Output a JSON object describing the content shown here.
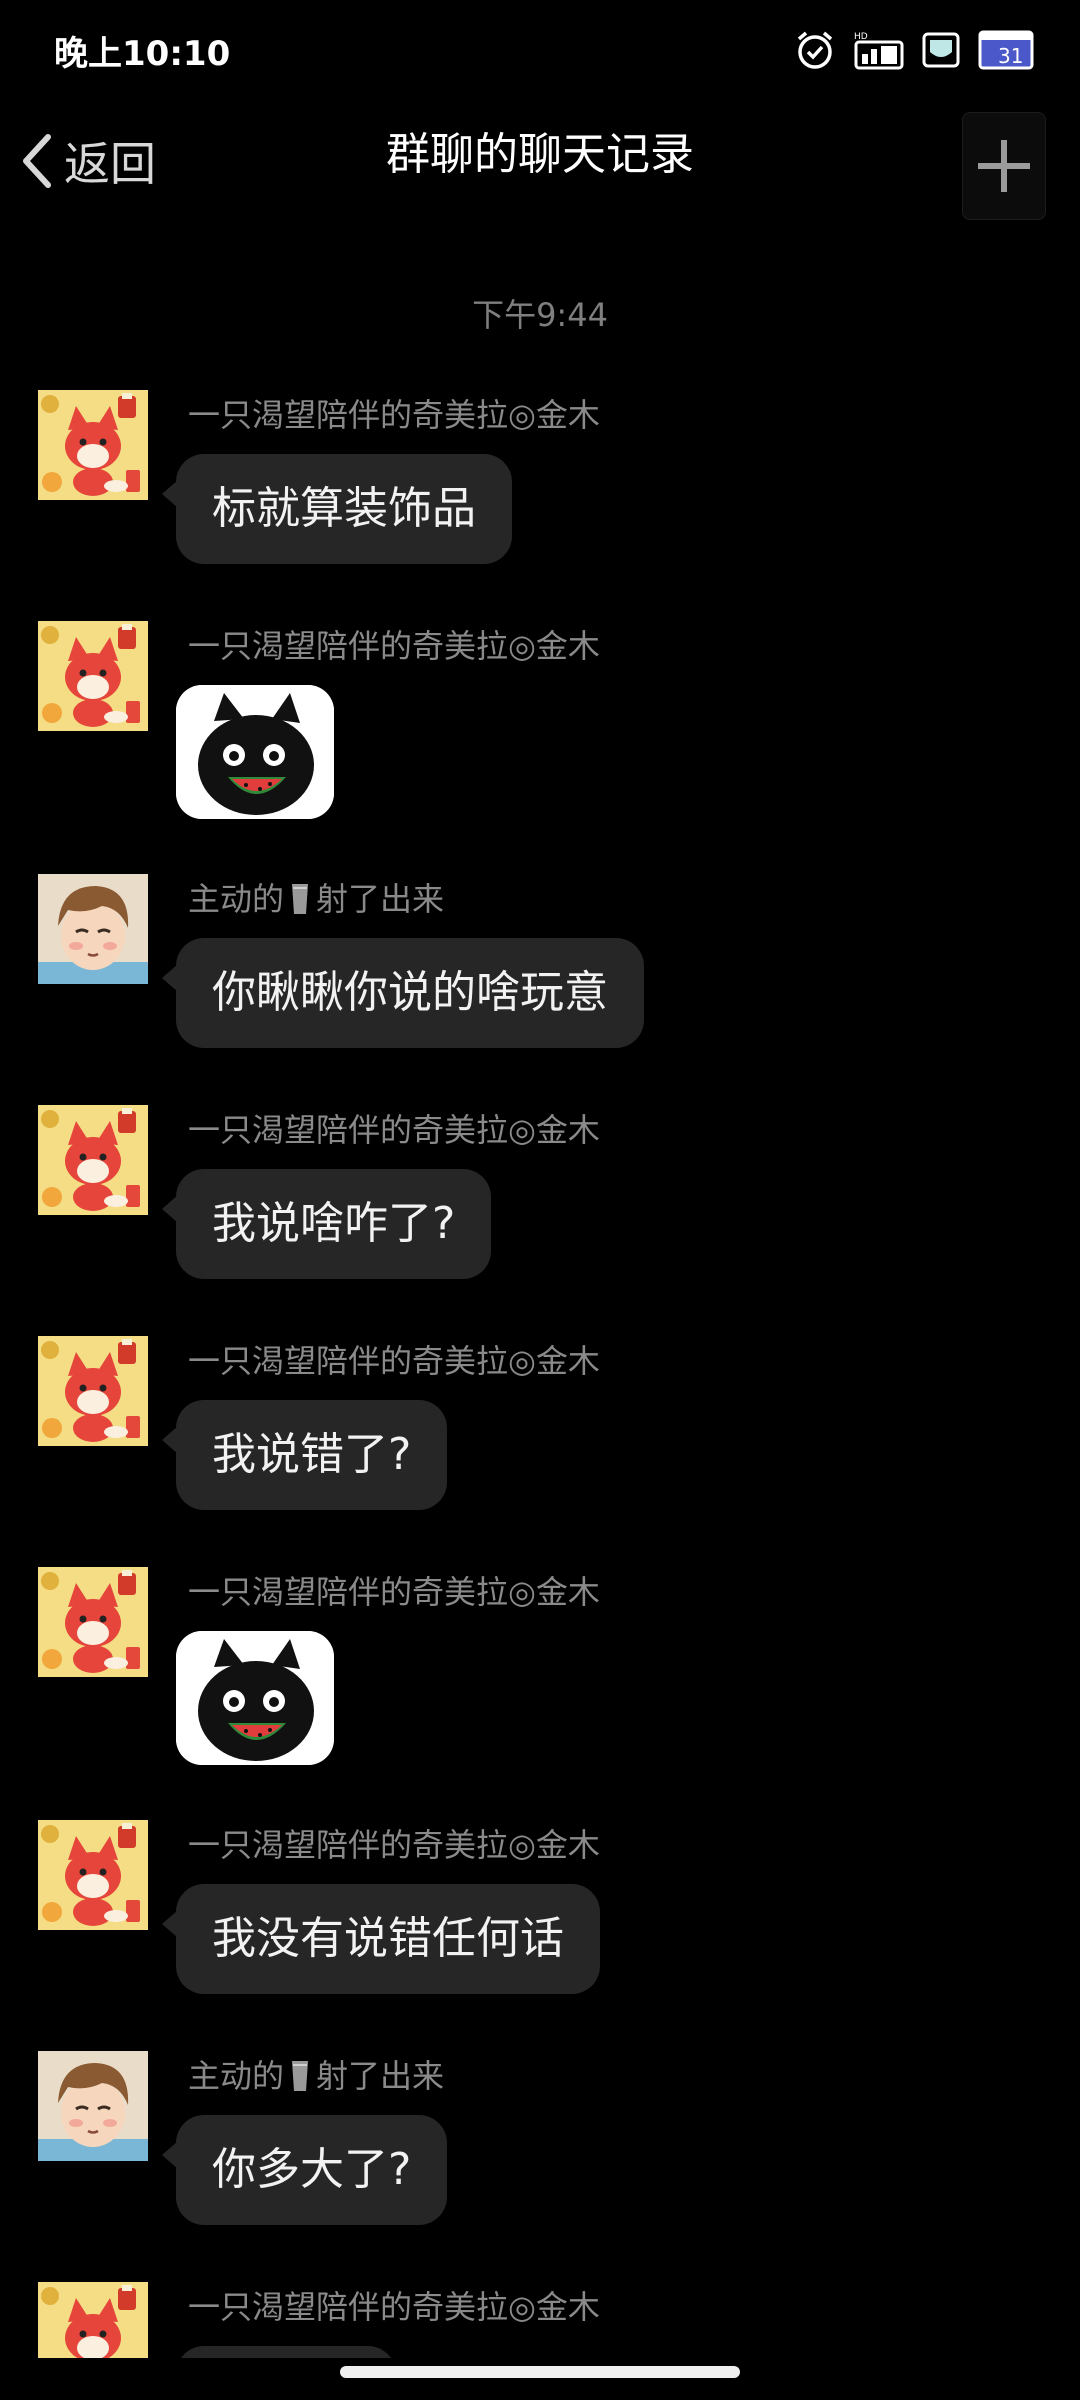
{
  "status_bar": {
    "time": "晚上10:10",
    "icons": [
      "alarm-icon",
      "hd-signal-icon",
      "battery-saver-icon",
      "calendar-icon"
    ],
    "calendar_day": "31",
    "hd_text": "HD"
  },
  "nav": {
    "back_label": "返回",
    "title": "群聊的聊天记录",
    "plus_icon": "plus-icon"
  },
  "timestamp": "下午9:44",
  "senders": {
    "fox": "一只渴望陪伴的奇美拉◎金木",
    "boy_name_before": "主动的",
    "boy_name_after": "射了出来"
  },
  "messages": [
    {
      "sender": "fox",
      "type": "text",
      "text": "标就算装饰品"
    },
    {
      "sender": "fox",
      "type": "sticker",
      "sticker": "black-cat-watermelon-sticker"
    },
    {
      "sender": "boy",
      "type": "text",
      "text": "你瞅瞅你说的啥玩意"
    },
    {
      "sender": "fox",
      "type": "text",
      "text": "我说啥咋了?"
    },
    {
      "sender": "fox",
      "type": "text",
      "text": "我说错了?"
    },
    {
      "sender": "fox",
      "type": "sticker",
      "sticker": "black-cat-watermelon-sticker"
    },
    {
      "sender": "fox",
      "type": "text",
      "text": "我没有说错任何话"
    },
    {
      "sender": "boy",
      "type": "text",
      "text": "你多大了?"
    },
    {
      "sender": "fox",
      "type": "text",
      "text": ""
    }
  ],
  "colors": {
    "background": "#000000",
    "bubble": "#262626",
    "sender_text": "#8a8a8a",
    "timestamp_text": "#7f7f7f"
  }
}
